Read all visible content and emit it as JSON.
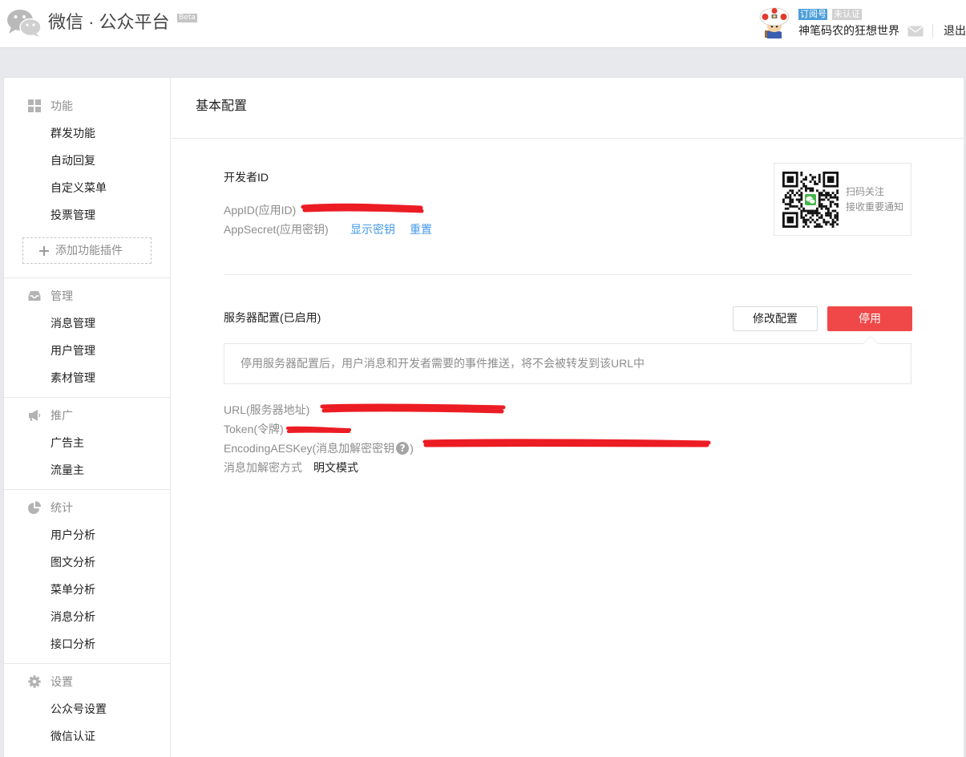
{
  "header": {
    "logo_icon": "wechat-logo-icon",
    "title": "微信 · 公众平台",
    "beta": "Beta",
    "account_type": "订阅号",
    "verification_status": "未认证",
    "account_name": "神笔码农的狂想世界",
    "mail_icon": "mail-icon",
    "logout": "退出"
  },
  "sidebar": {
    "sections": [
      {
        "title": "功能",
        "icon": "grid-icon",
        "items": [
          "群发功能",
          "自动回复",
          "自定义菜单",
          "投票管理"
        ],
        "add_plugin_icon": "plus-icon",
        "add_plugin": "添加功能插件"
      },
      {
        "title": "管理",
        "icon": "inbox-icon",
        "items": [
          "消息管理",
          "用户管理",
          "素材管理"
        ]
      },
      {
        "title": "推广",
        "icon": "megaphone-icon",
        "items": [
          "广告主",
          "流量主"
        ]
      },
      {
        "title": "统计",
        "icon": "pie-chart-icon",
        "items": [
          "用户分析",
          "图文分析",
          "菜单分析",
          "消息分析",
          "接口分析"
        ]
      },
      {
        "title": "设置",
        "icon": "gear-icon",
        "items": [
          "公众号设置",
          "微信认证"
        ]
      }
    ]
  },
  "main": {
    "page_title": "基本配置",
    "developer": {
      "title": "开发者ID",
      "appid_label": "AppID(应用ID)",
      "appsecret_label": "AppSecret(应用密钥)",
      "show_secret": "显示密钥",
      "reset": "重置"
    },
    "qr_card": {
      "icon": "qr-code-image",
      "line1": "扫码关注",
      "line2": "接收重要通知"
    },
    "server": {
      "title": "服务器配置(已启用)",
      "modify_button": "修改配置",
      "disable_button": "停用",
      "disable_notice": "停用服务器配置后，用户消息和开发者需要的事件推送，将不会被转发到该URL中",
      "url_label": "URL(服务器地址)",
      "token_label": "Token(令牌)",
      "aeskey_label": "EncodingAESKey(消息加解密密钥",
      "aeskey_help": "?",
      "aeskey_label_end": ")",
      "mode_label": "消息加解密方式",
      "mode_value": "明文模式"
    }
  },
  "colors": {
    "page_bg": "#e8e9ec",
    "link": "#459ae9",
    "danger": "#f04848",
    "badge_subscription": "#4c9fd9",
    "badge_unverified": "#d0d0d0",
    "redaction": "#ec1c24",
    "wechat_green": "#44b549"
  }
}
